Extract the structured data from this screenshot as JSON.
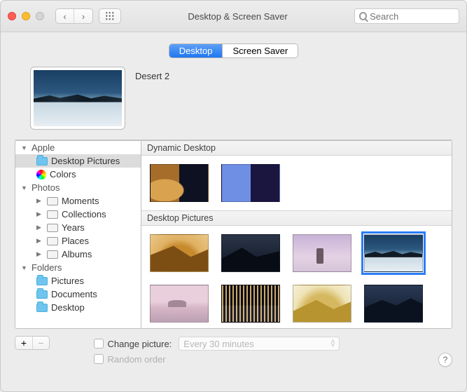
{
  "window": {
    "title": "Desktop & Screen Saver"
  },
  "search": {
    "placeholder": "Search"
  },
  "tabs": {
    "desktop": "Desktop",
    "screensaver": "Screen Saver"
  },
  "hero": {
    "name": "Desert 2"
  },
  "sidebar": {
    "apple": "Apple",
    "apple_items": {
      "desktop_pictures": "Desktop Pictures",
      "colors": "Colors"
    },
    "photos": "Photos",
    "photos_items": {
      "moments": "Moments",
      "collections": "Collections",
      "years": "Years",
      "places": "Places",
      "albums": "Albums"
    },
    "folders": "Folders",
    "folders_items": {
      "pictures": "Pictures",
      "documents": "Documents",
      "desktop": "Desktop"
    }
  },
  "gallery": {
    "section_dynamic": "Dynamic Desktop",
    "section_desktop": "Desktop Pictures"
  },
  "footer": {
    "change_picture": "Change picture:",
    "random_order": "Random order",
    "interval": "Every 30 minutes",
    "help": "?"
  },
  "icons": {
    "plus": "+",
    "minus": "−",
    "back": "‹",
    "forward": "›",
    "chev_up": "˄",
    "chev_down": "˅"
  }
}
